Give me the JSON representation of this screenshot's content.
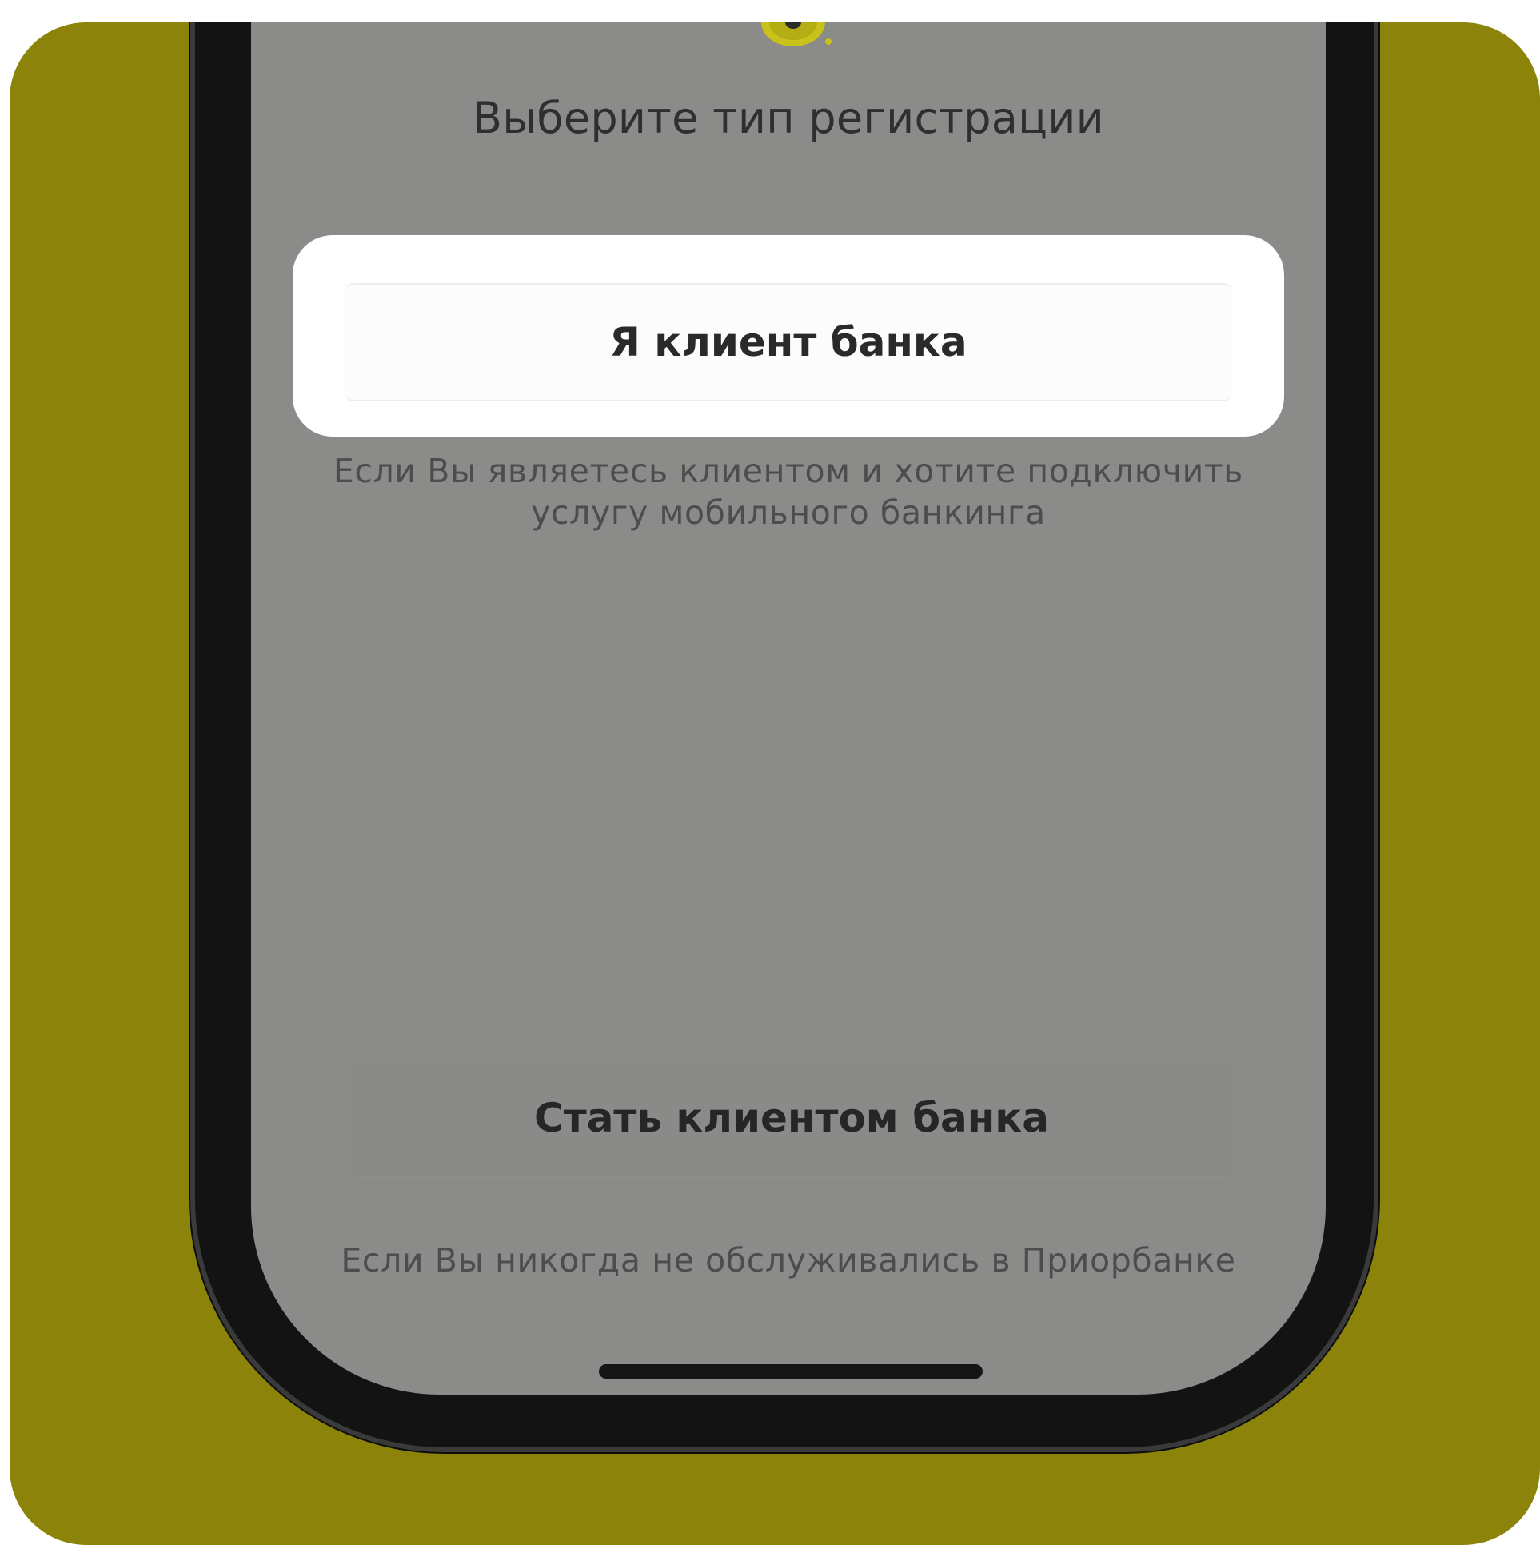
{
  "screen": {
    "title": "Выберите тип регистрации",
    "client_button_label": "Я клиент банка",
    "client_description": "Если Вы являетесь клиентом и хотите подключить услугу мобильного банкинга",
    "become_client_button_label": "Стать клиентом банка",
    "become_client_description": "Если Вы никогда не обслуживались в Приорбанке"
  },
  "icons": {
    "logo": "bank-logo-icon"
  },
  "colors": {
    "background": "#8c840a",
    "screen_overlay": "#8b8b89",
    "highlight": "#ffffff",
    "logo_accent": "#c8c21a"
  }
}
